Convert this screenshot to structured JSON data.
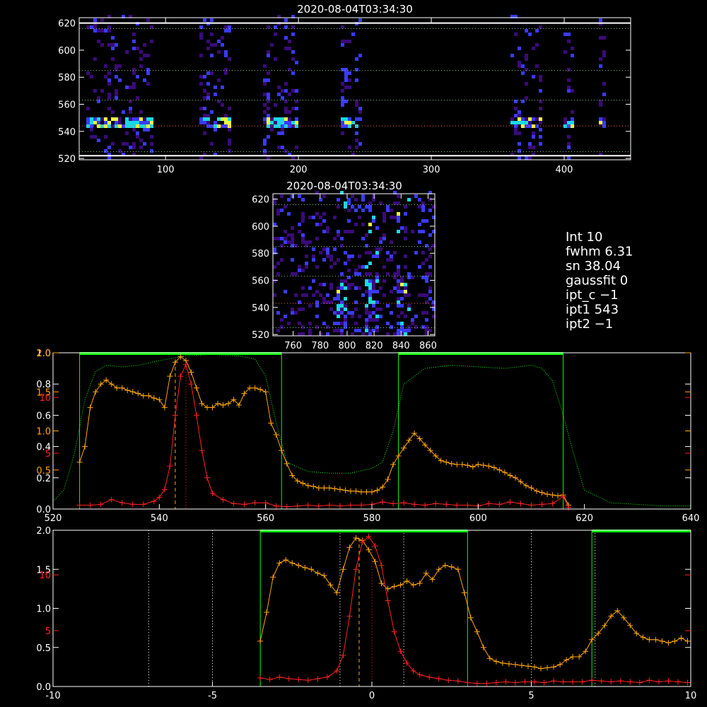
{
  "colors": {
    "background": "#000000",
    "axis": "#ffffff",
    "green": "#00ff00",
    "orange": "#ffa500",
    "red": "#ff2020",
    "grid_green": "#7fd07f",
    "grid_red": "#ff6040",
    "heat_low": "#3a0a7a",
    "heat_mid": "#3a3aff",
    "heat_high": "#19d9e6",
    "heat_peak": "#f0ff40"
  },
  "chart_data": [
    {
      "type": "heatmap",
      "title": "2020-08-04T03:34:30",
      "xlim": [
        35,
        450
      ],
      "ylim": [
        519,
        624
      ],
      "xticks": [
        100,
        200,
        300,
        400
      ],
      "yticks": [
        520,
        540,
        560,
        580,
        600,
        620
      ],
      "hlines_green": [
        525,
        563,
        585,
        616
      ],
      "hlines_white": [
        522,
        620
      ],
      "hline_red": 544,
      "bright_band_y": 544,
      "column_blocks": [
        [
          40,
          90
        ],
        [
          123,
          148
        ],
        [
          172,
          198
        ],
        [
          230,
          246
        ],
        [
          357,
          382
        ],
        [
          399,
          405
        ],
        [
          426,
          430
        ]
      ]
    },
    {
      "type": "heatmap",
      "title": "2020-08-04T03:34:30",
      "xlim": [
        745,
        865
      ],
      "ylim": [
        519,
        624
      ],
      "xticks": [
        760,
        780,
        800,
        820,
        840,
        860
      ],
      "yticks": [
        520,
        540,
        560,
        580,
        600,
        620
      ],
      "hlines_green": [
        525,
        563,
        585,
        616
      ],
      "hline_red": 543,
      "bright_columns": [
        [
          792,
          798
        ],
        [
          812,
          822
        ],
        [
          836,
          846
        ]
      ]
    },
    {
      "type": "line",
      "xlim": [
        520,
        640
      ],
      "xticks": [
        520,
        540,
        560,
        580,
        600,
        620,
        640
      ],
      "yticks_left_white": [
        0.0,
        0.2,
        0.4,
        0.6,
        0.8,
        1.0
      ],
      "yticks_left_orange": [
        0.5,
        1.0,
        1.5,
        2.0
      ],
      "yticks_left_red": [
        5,
        10
      ],
      "series": [
        {
          "color": "green",
          "style": "dotted",
          "x": [
            520,
            522,
            524,
            526,
            528,
            530,
            533,
            536,
            540,
            545,
            550,
            555,
            558,
            560,
            562,
            564,
            568,
            572,
            576,
            580,
            582,
            584,
            586,
            590,
            595,
            600,
            605,
            610,
            612,
            614,
            616,
            618,
            620,
            625,
            630,
            635,
            640
          ],
          "y": [
            0.05,
            0.12,
            0.35,
            0.7,
            0.88,
            0.92,
            0.91,
            0.92,
            0.95,
            0.98,
            0.99,
            0.98,
            0.96,
            0.85,
            0.55,
            0.3,
            0.24,
            0.23,
            0.23,
            0.26,
            0.3,
            0.5,
            0.8,
            0.9,
            0.92,
            0.91,
            0.9,
            0.92,
            0.9,
            0.82,
            0.6,
            0.35,
            0.12,
            0.04,
            0.03,
            0.02,
            0.02
          ]
        },
        {
          "color": "orange",
          "marker": "+",
          "x": [
            525,
            526,
            527,
            528,
            529,
            530,
            531,
            532,
            533,
            534,
            535,
            536,
            537,
            538,
            539,
            540,
            541,
            542,
            543,
            544,
            545,
            546,
            547,
            548,
            549,
            550,
            551,
            552,
            553,
            554,
            555,
            556,
            557,
            558,
            559,
            560,
            561,
            562,
            563,
            564,
            565,
            566,
            567,
            568,
            569,
            570,
            571,
            572,
            573,
            574,
            575,
            576,
            577,
            578,
            579,
            580,
            581,
            582,
            583,
            584,
            585,
            586,
            587,
            588,
            589,
            590,
            591,
            592,
            593,
            594,
            595,
            596,
            597,
            598,
            599,
            600,
            601,
            602,
            603,
            604,
            605,
            606,
            607,
            608,
            609,
            610,
            611,
            612,
            613,
            614,
            615,
            616,
            617
          ],
          "y": [
            0.6,
            0.8,
            1.3,
            1.5,
            1.6,
            1.65,
            1.6,
            1.55,
            1.55,
            1.52,
            1.5,
            1.48,
            1.45,
            1.45,
            1.42,
            1.4,
            1.3,
            1.7,
            1.88,
            1.95,
            1.9,
            1.75,
            1.55,
            1.35,
            1.3,
            1.3,
            1.35,
            1.33,
            1.35,
            1.4,
            1.33,
            1.48,
            1.55,
            1.55,
            1.53,
            1.5,
            1.1,
            0.95,
            0.75,
            0.58,
            0.43,
            0.36,
            0.33,
            0.3,
            0.29,
            0.27,
            0.27,
            0.27,
            0.26,
            0.25,
            0.24,
            0.23,
            0.23,
            0.22,
            0.22,
            0.22,
            0.24,
            0.28,
            0.38,
            0.57,
            0.68,
            0.78,
            0.88,
            0.97,
            0.9,
            0.82,
            0.75,
            0.68,
            0.62,
            0.6,
            0.58,
            0.57,
            0.57,
            0.56,
            0.54,
            0.57,
            0.56,
            0.55,
            0.53,
            0.5,
            0.47,
            0.43,
            0.4,
            0.35,
            0.3,
            0.27,
            0.23,
            0.21,
            0.19,
            0.18,
            0.17,
            0.18,
            0.05
          ]
        },
        {
          "color": "red",
          "marker": "+",
          "x": [
            525,
            527,
            529,
            531,
            533,
            535,
            537,
            539,
            540,
            541,
            542,
            543,
            544,
            545,
            546,
            547,
            548,
            549,
            550,
            552,
            554,
            556,
            558,
            560,
            562,
            564,
            566,
            568,
            570,
            572,
            574,
            576,
            578,
            580,
            582,
            584,
            586,
            588,
            590,
            592,
            594,
            596,
            598,
            600,
            602,
            604,
            606,
            608,
            610,
            612,
            614,
            616,
            617
          ],
          "y": [
            0.05,
            0.05,
            0.06,
            0.12,
            0.08,
            0.06,
            0.06,
            0.1,
            0.15,
            0.25,
            0.55,
            1.2,
            1.7,
            1.85,
            1.6,
            1.2,
            0.75,
            0.4,
            0.2,
            0.12,
            0.07,
            0.06,
            0.08,
            0.08,
            0.04,
            0.03,
            0.04,
            0.05,
            0.04,
            0.05,
            0.04,
            0.05,
            0.05,
            0.06,
            0.09,
            0.07,
            0.08,
            0.06,
            0.05,
            0.07,
            0.06,
            0.05,
            0.05,
            0.04,
            0.07,
            0.06,
            0.09,
            0.07,
            0.05,
            0.06,
            0.07,
            0.16,
            0.02
          ]
        }
      ],
      "green_windows": [
        [
          525,
          563
        ],
        [
          585,
          616
        ]
      ],
      "vline_orange_dashed": 543,
      "vline_red_dotted": 545
    },
    {
      "type": "line",
      "xlim": [
        -10,
        10
      ],
      "xticks": [
        -10,
        -5,
        0,
        5,
        10
      ],
      "yticks_left_white": [
        0.0,
        0.5,
        1.0,
        1.5,
        2.0
      ],
      "yticks_left_red": [
        5,
        10
      ],
      "series": [
        {
          "color": "orange",
          "marker": "+",
          "x": [
            -3.5,
            -3.3,
            -3.1,
            -2.9,
            -2.7,
            -2.5,
            -2.3,
            -2.1,
            -1.9,
            -1.7,
            -1.5,
            -1.3,
            -1.1,
            -0.9,
            -0.7,
            -0.5,
            -0.3,
            -0.1,
            0.1,
            0.3,
            0.5,
            0.7,
            0.9,
            1.1,
            1.3,
            1.5,
            1.7,
            1.9,
            2.1,
            2.3,
            2.5,
            2.7,
            2.9,
            3.1,
            3.3,
            3.5,
            3.7,
            3.9,
            4.1,
            4.3,
            4.5,
            4.7,
            4.9,
            5.1,
            5.3,
            5.5,
            5.7,
            5.9,
            6.1,
            6.3,
            6.5,
            6.7,
            6.9,
            7.1,
            7.3,
            7.5,
            7.7,
            7.9,
            8.1,
            8.3,
            8.5,
            8.7,
            8.9,
            9.1,
            9.3,
            9.5,
            9.7,
            9.9
          ],
          "y": [
            0.58,
            0.95,
            1.4,
            1.58,
            1.62,
            1.58,
            1.55,
            1.52,
            1.5,
            1.45,
            1.42,
            1.3,
            1.2,
            1.5,
            1.78,
            1.9,
            1.87,
            1.75,
            1.6,
            1.32,
            1.25,
            1.28,
            1.3,
            1.35,
            1.3,
            1.32,
            1.45,
            1.37,
            1.5,
            1.55,
            1.53,
            1.5,
            1.2,
            0.88,
            0.7,
            0.5,
            0.36,
            0.32,
            0.3,
            0.29,
            0.28,
            0.27,
            0.26,
            0.25,
            0.23,
            0.24,
            0.25,
            0.28,
            0.34,
            0.38,
            0.38,
            0.45,
            0.6,
            0.68,
            0.78,
            0.9,
            0.97,
            0.88,
            0.78,
            0.68,
            0.63,
            0.6,
            0.6,
            0.58,
            0.56,
            0.58,
            0.62,
            0.58
          ]
        },
        {
          "color": "red",
          "marker": "+",
          "x": [
            -3.5,
            -3.2,
            -2.9,
            -2.6,
            -2.3,
            -2.0,
            -1.7,
            -1.4,
            -1.1,
            -0.9,
            -0.7,
            -0.5,
            -0.3,
            -0.1,
            0.1,
            0.3,
            0.5,
            0.7,
            0.9,
            1.1,
            1.3,
            1.5,
            1.8,
            2.1,
            2.4,
            2.7,
            3.0,
            3.3,
            3.6,
            3.9,
            4.2,
            4.5,
            4.8,
            5.1,
            5.4,
            5.7,
            6.0,
            6.3,
            6.6,
            6.9,
            7.2,
            7.5,
            7.8,
            8.1,
            8.4,
            8.7,
            9.0,
            9.3,
            9.6,
            9.9
          ],
          "y": [
            0.11,
            0.09,
            0.12,
            0.1,
            0.09,
            0.08,
            0.1,
            0.12,
            0.2,
            0.4,
            0.9,
            1.5,
            1.85,
            1.92,
            1.8,
            1.55,
            1.1,
            0.7,
            0.45,
            0.3,
            0.2,
            0.15,
            0.12,
            0.1,
            0.08,
            0.07,
            0.05,
            0.04,
            0.04,
            0.05,
            0.06,
            0.05,
            0.06,
            0.06,
            0.05,
            0.07,
            0.06,
            0.06,
            0.06,
            0.08,
            0.07,
            0.06,
            0.07,
            0.06,
            0.05,
            0.08,
            0.06,
            0.07,
            0.06,
            0.05
          ]
        }
      ],
      "green_windows": [
        [
          -3.5,
          3.0
        ],
        [
          6.9,
          10.0
        ]
      ],
      "vlines_white_dotted": [
        -7,
        -5,
        -1,
        1,
        5,
        7
      ],
      "vline_orange_dashed": -0.4,
      "vline_red_dotted": 0.0
    }
  ],
  "info_panel": {
    "lines": [
      "Int      10",
      "fwhm    6.31",
      "sn     38.04",
      "gaussfit 0",
      "ipt_c   −1",
      "ipt1  543",
      "ipt2   −1"
    ]
  }
}
